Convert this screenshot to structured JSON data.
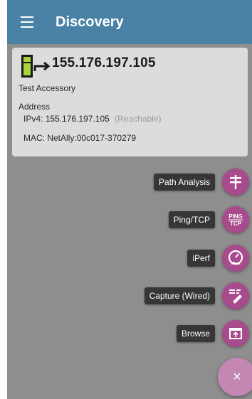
{
  "app_bar": {
    "title": "Discovery",
    "color": "#4a82a6",
    "menu_icon": "hamburger-menu-icon"
  },
  "device_card": {
    "icon": "test-accessory-icon",
    "ip": "155.176.197.105",
    "subtitle": "Test Accessory",
    "section_label": "Address",
    "ipv4_label": "IPv4:",
    "ipv4_value": "155.176.197.105",
    "ipv4_status": "(Reachable)",
    "mac_label": "MAC:",
    "mac_value": "NetAlly:00c017-370279"
  },
  "actions": [
    {
      "label": "Path Analysis",
      "icon": "path-analysis-icon"
    },
    {
      "label": "Ping/TCP",
      "icon": "ping-tcp-icon",
      "icon_text": [
        "PING",
        "TCP"
      ]
    },
    {
      "label": "iPerf",
      "icon": "iperf-gauge-icon",
      "icon_text": "Mbps"
    },
    {
      "label": "Capture (Wired)",
      "icon": "capture-wired-icon"
    },
    {
      "label": "Browse",
      "icon": "browse-icon"
    }
  ],
  "main_fab": {
    "icon": "close-icon",
    "glyph": "×"
  },
  "colors": {
    "fab": "#a84b8c",
    "fab_main": "#c486b3",
    "overlay": "#8e8e8e"
  }
}
